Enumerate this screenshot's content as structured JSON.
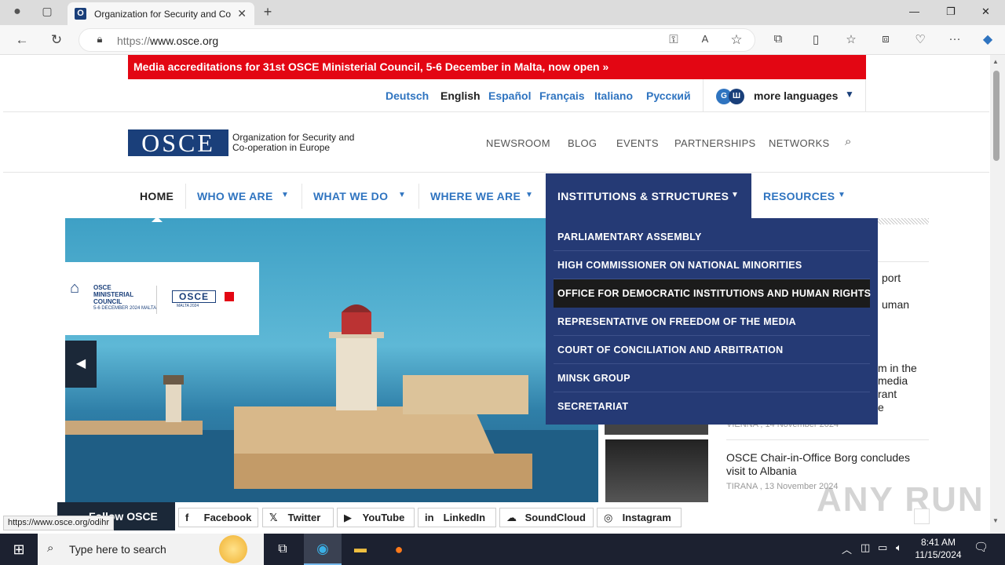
{
  "browser": {
    "tab_title": "Organization for Security and Co",
    "tab_favicon": "O",
    "url_scheme": "https://",
    "url_host": "www.osce.org"
  },
  "banner": {
    "text": "Media accreditations for 31st OSCE Ministerial Council, 5-6 December in Malta, now open  »",
    "color": "#e30613"
  },
  "languages": [
    "Deutsch",
    "English",
    "Español",
    "Français",
    "Italiano",
    "Русский"
  ],
  "current_language": "English",
  "more_languages": {
    "label": "more languages",
    "badge1": "G",
    "badge2": "Ш"
  },
  "logo": {
    "mark": "OSCE",
    "line1": "Organization for Security and",
    "line2": "Co-operation in Europe"
  },
  "top_nav": [
    "NEWSROOM",
    "BLOG",
    "EVENTS",
    "PARTNERSHIPS",
    "NETWORKS"
  ],
  "main_nav": {
    "home": "HOME",
    "who_we_are": "WHO WE ARE",
    "what_we_do": "WHAT WE DO",
    "where_we_are": "WHERE WE ARE",
    "institutions": "INSTITUTIONS & STRUCTURES",
    "resources": "RESOURCES"
  },
  "dropdown_items": [
    "PARLIAMENTARY ASSEMBLY",
    "HIGH COMMISSIONER ON NATIONAL MINORITIES",
    "OFFICE FOR DEMOCRATIC INSTITUTIONS AND HUMAN RIGHTS",
    "REPRESENTATIVE ON FREEDOM OF THE MEDIA",
    "COURT OF CONCILIATION AND ARBITRATION",
    "MINSK GROUP",
    "SECRETARIAT"
  ],
  "hero": {
    "logo_line1": "OSCE",
    "logo_line2": "MINISTERIAL",
    "logo_line3": "COUNCIL",
    "logo_date": "5-6 DECEMBER 2024  MALTA",
    "logo_mark": "OSCE",
    "logo_mark_sub": "MALTA 2024"
  },
  "news": [
    {
      "partial1": "port",
      "partial2": "uman"
    },
    {
      "partial1": "m in the",
      "partial2": "media",
      "partial3": "rant",
      "partial4": "e",
      "meta": "VIENNA , 14 November 2024"
    },
    {
      "title": "OSCE Chair-in-Office Borg concludes visit to Albania",
      "meta": "TIRANA , 13 November 2024"
    }
  ],
  "social": {
    "follow": "Follow OSCE",
    "items": [
      "Facebook",
      "Twitter",
      "YouTube",
      "LinkedIn",
      "SoundCloud",
      "Instagram"
    ]
  },
  "status_bar": "https://www.osce.org/odihr",
  "watermark": "ANY  RUN",
  "taskbar": {
    "search_placeholder": "Type here to search",
    "time": "8:41 AM",
    "date": "11/15/2024"
  },
  "colors": {
    "osce_blue": "#1a3f7a",
    "link_blue": "#2f74c0",
    "dropdown_bg": "#253a75"
  }
}
